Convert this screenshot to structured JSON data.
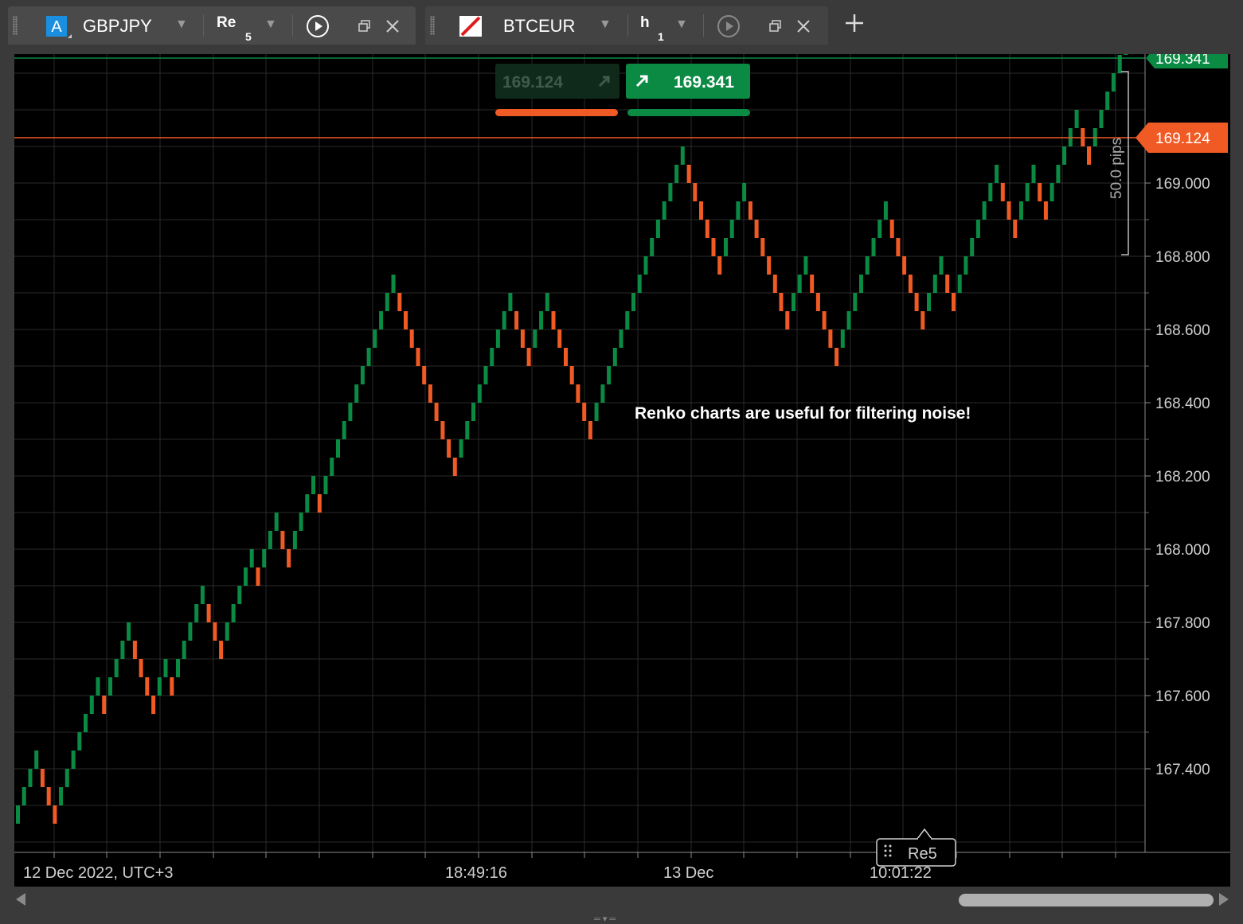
{
  "tabs": [
    {
      "badge": "A",
      "symbol": "GBPJPY",
      "timeframe": "Re",
      "timeframe_sub": "5",
      "active": true
    },
    {
      "badge": "flag-icon",
      "symbol": "BTCEUR",
      "timeframe": "h",
      "timeframe_sub": "1",
      "active": false
    }
  ],
  "quote": {
    "bid": "169.124",
    "ask": "169.341",
    "bid_color": "#f05a24",
    "ask_color": "#0b8a44"
  },
  "price_axis": {
    "labels": [
      "169.000",
      "168.800",
      "168.600",
      "168.400",
      "168.200",
      "168.000",
      "167.800",
      "167.600",
      "167.400"
    ],
    "current_bid": "169.124",
    "current_ask": "169.341",
    "ruler_label": "50.0 pips"
  },
  "time_axis": {
    "labels": [
      "12 Dec 2022, UTC+3",
      "18:49:16",
      "13 Dec",
      "10:01:22"
    ]
  },
  "annotation": "Renko charts are useful for filtering noise!",
  "chart_tag": "Re5",
  "colors": {
    "up": "#0b8a44",
    "down": "#f05a24",
    "background": "#000000",
    "grid": "#2a2a2a"
  },
  "chart_data": {
    "type": "renko",
    "symbol": "GBPJPY",
    "brick_size": 0.05,
    "ylim": [
      167.2,
      169.4
    ],
    "start_price": 167.25,
    "bricks": [
      1,
      1,
      1,
      1,
      -1,
      -1,
      -1,
      1,
      1,
      1,
      1,
      1,
      1,
      1,
      -1,
      1,
      1,
      1,
      1,
      -1,
      -1,
      -1,
      -1,
      1,
      1,
      -1,
      1,
      1,
      1,
      1,
      1,
      -1,
      -1,
      -1,
      1,
      1,
      1,
      1,
      1,
      -1,
      1,
      1,
      1,
      -1,
      -1,
      1,
      1,
      1,
      1,
      -1,
      1,
      1,
      1,
      1,
      1,
      1,
      1,
      1,
      1,
      1,
      1,
      1,
      -1,
      -1,
      -1,
      -1,
      -1,
      -1,
      -1,
      -1,
      -1,
      -1,
      1,
      1,
      1,
      1,
      1,
      1,
      1,
      1,
      1,
      -1,
      -1,
      -1,
      1,
      1,
      1,
      -1,
      -1,
      -1,
      -1,
      -1,
      -1,
      -1,
      1,
      1,
      1,
      1,
      1,
      1,
      1,
      1,
      1,
      1,
      1,
      1,
      1,
      1,
      1,
      -1,
      -1,
      -1,
      -1,
      -1,
      -1,
      1,
      1,
      1,
      1,
      -1,
      -1,
      -1,
      -1,
      -1,
      -1,
      -1,
      1,
      1,
      1,
      -1,
      -1,
      -1,
      -1,
      -1,
      1,
      1,
      1,
      1,
      1,
      1,
      1,
      1,
      -1,
      -1,
      -1,
      -1,
      -1,
      -1,
      1,
      1,
      1,
      -1,
      -1,
      1,
      1,
      1,
      1,
      1,
      1,
      1,
      -1,
      -1,
      -1,
      1,
      1,
      1,
      -1,
      -1,
      1,
      1,
      1,
      1,
      1,
      -1,
      -1,
      1,
      1,
      1,
      1,
      1,
      1,
      1
    ]
  }
}
